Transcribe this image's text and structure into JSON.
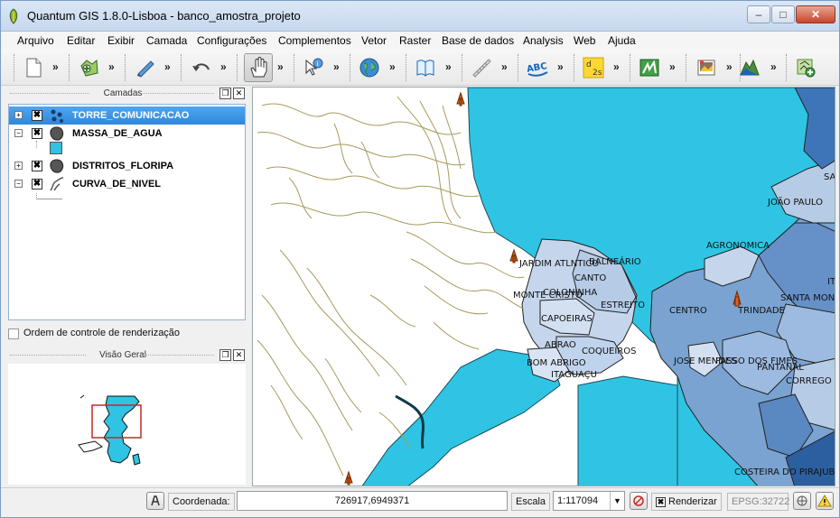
{
  "window": {
    "title": "Quantum GIS 1.8.0-Lisboa - banco_amostra_projeto",
    "minimize": "–",
    "maximize": "□",
    "close": "✕"
  },
  "menu": [
    "Arquivo",
    "Editar",
    "Exibir",
    "Camada",
    "Configurações",
    "Complementos",
    "Vetor",
    "Raster",
    "Base de dados",
    "Analysis",
    "Web",
    "Ajuda"
  ],
  "toolbar": {
    "more": "»",
    "buttons": [
      "new-project-icon",
      "add-vector-icon",
      "digitize-pencil-icon",
      "undo-icon",
      "pan-hand-icon",
      "identify-icon",
      "globe-icon",
      "help-book-icon",
      "measure-icon",
      "label-abc-icon",
      "d2s-icon",
      "grass-icon",
      "image-icon",
      "terrain-icon",
      "plugin-add-icon"
    ],
    "active": "pan-hand-icon",
    "d2s_text": "d2s",
    "abc_text": "ABC"
  },
  "layers_panel": {
    "title": "Camadas",
    "layers": [
      {
        "name": "TORRE_COMUNICACAO",
        "expand": "+",
        "checked": "✖",
        "selected": true
      },
      {
        "name": "MASSA_DE_AGUA",
        "expand": "−",
        "checked": "✖",
        "selected": false
      },
      {
        "name": "DISTRITOS_FLORIPA",
        "expand": "+",
        "checked": "✖",
        "selected": false
      },
      {
        "name": "CURVA_DE_NIVEL",
        "expand": "−",
        "checked": "✖",
        "selected": false
      }
    ],
    "render_order_label": "Ordem de controle de renderização"
  },
  "overview_panel": {
    "title": "Visão Geral"
  },
  "map_labels": [
    "JARDIM ATLNTICO",
    "BALNEÁRIO",
    "CANTO",
    "COLONINHA",
    "MONTE CRISTO",
    "ESTREITO",
    "CAPOEIRAS",
    "ABRAO",
    "COQUEIROS",
    "BOM ABRIGO",
    "ITAGUAÇU",
    "CENTRO",
    "TRINDADE",
    "AGRONOMICA",
    "JOÃO PAULO",
    "SANTA MONICA",
    "JOSE MENDES",
    "PASSO DOS FIMES",
    "PANTANAL",
    "CORREGO GRANDE",
    "COSTEIRA DO PIRAJUBAÉ",
    "SA",
    "IT"
  ],
  "status": {
    "coord_label": "Coordenada:",
    "coord_value": "726917,6949371",
    "scale_label": "Escala",
    "scale_value": "1:117094",
    "render_label": "Renderizar",
    "render_checked": "✖",
    "epsg": "EPSG:32722"
  },
  "colors": {
    "water": "#2fc4e3",
    "selection": "#2f87dc",
    "contour": "#a89a5c",
    "district_light": "#c5d6ec",
    "district_mid": "#7aa3d1",
    "district_dark": "#2c5fa0",
    "tower": "#e0601a"
  }
}
